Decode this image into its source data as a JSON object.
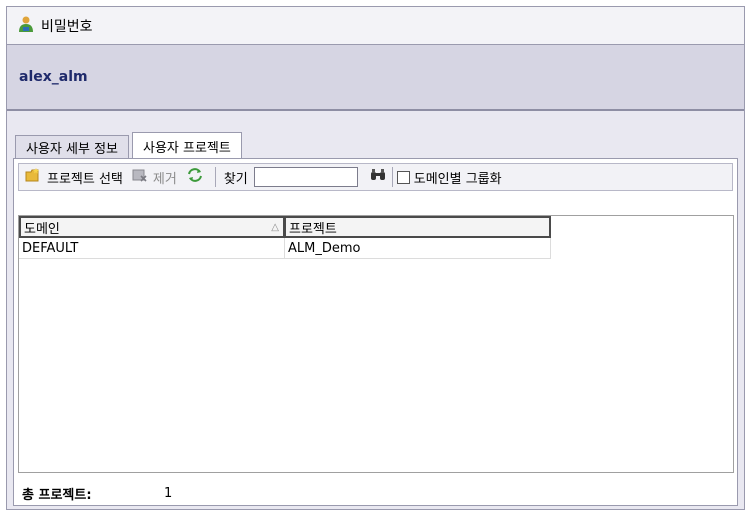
{
  "window": {
    "title": "비밀번호",
    "title_icon": "user-icon"
  },
  "user": {
    "name": "alex_alm"
  },
  "tabs": [
    {
      "label": "사용자 세부 정보",
      "active": false
    },
    {
      "label": "사용자 프로젝트",
      "active": true
    }
  ],
  "toolbar": {
    "select_project_label": "프로젝트 선택",
    "remove_label": "제거",
    "find_label": "찾기",
    "find_value": "",
    "group_by_domain_label": "도메인별 그룹화",
    "group_by_domain_checked": false
  },
  "grid": {
    "columns": [
      "도메인",
      "프로젝트"
    ],
    "sort_indicator": "△",
    "rows": [
      {
        "domain": "DEFAULT",
        "project": "ALM_Demo"
      }
    ]
  },
  "footer": {
    "total_label": "총 프로젝트:",
    "total_value": "1"
  },
  "colors": {
    "panel": "#d6d5e3",
    "username": "#1f2a6b",
    "frame": "#e9e8f1"
  }
}
